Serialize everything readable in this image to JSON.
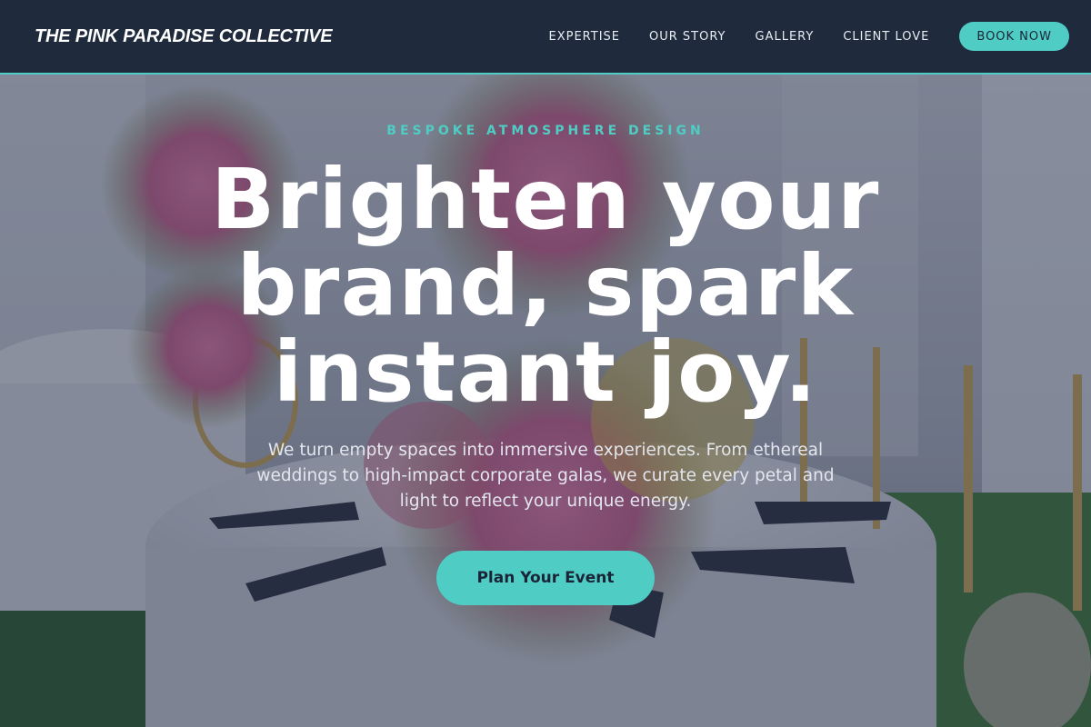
{
  "nav": {
    "brand": "THE PINK PARADISE COLLECTIVE",
    "links": [
      "EXPERTISE",
      "OUR STORY",
      "GALLERY",
      "CLIENT LOVE"
    ],
    "cta": "BOOK NOW"
  },
  "hero": {
    "eyebrow": "BESPOKE ATMOSPHERE DESIGN",
    "headline_lines": [
      "Brighten your",
      "brand, spark",
      "instant joy."
    ],
    "subtext": "We turn empty spaces into immersive experiences. From ethereal weddings to high-impact corporate galas, we curate every petal and light to reflect your unique energy.",
    "cta": "Plan Your Event"
  },
  "colors": {
    "nav_background": "#1f2a3d",
    "accent": "#4fcdc4",
    "headline": "#ffffff",
    "overlay": "#222a42"
  }
}
